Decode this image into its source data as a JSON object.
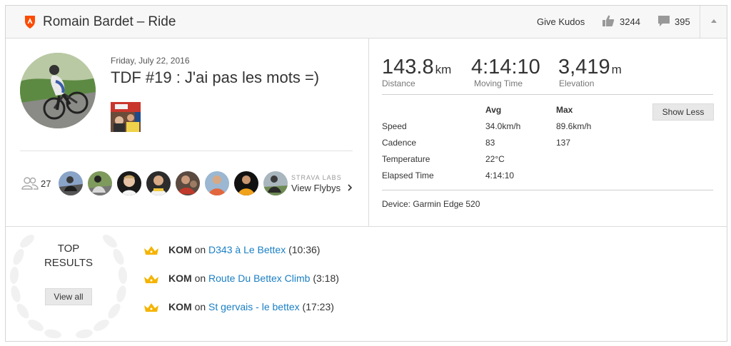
{
  "header": {
    "athlete_name": "Romain Bardet",
    "separator": "–",
    "activity_type": "Ride",
    "give_kudos_label": "Give Kudos",
    "kudos_count": "3244",
    "comment_count": "395"
  },
  "activity": {
    "date": "Friday, July 22, 2016",
    "name": "TDF #19 : J'ai pas les mots =)"
  },
  "group": {
    "athlete_count": "27",
    "labs_label": "STRAVA LABS",
    "flyby_label": "View Flybys"
  },
  "stats": {
    "distance": {
      "value": "143.8",
      "unit": "km",
      "label": "Distance"
    },
    "moving_time": {
      "value": "4:14:10",
      "label": "Moving Time"
    },
    "elevation": {
      "value": "3,419",
      "unit": "m",
      "label": "Elevation"
    },
    "table": {
      "col_avg": "Avg",
      "col_max": "Max",
      "rows": [
        {
          "label": "Speed",
          "avg": "34.0km/h",
          "max": "89.6km/h"
        },
        {
          "label": "Cadence",
          "avg": "83",
          "max": "137"
        },
        {
          "label": "Temperature",
          "avg": "22°C",
          "max": ""
        },
        {
          "label": "Elapsed Time",
          "avg": "4:14:10",
          "max": ""
        }
      ]
    },
    "show_less_label": "Show Less",
    "device": "Device: Garmin Edge 520"
  },
  "results": {
    "title": "TOP RESULTS",
    "view_all_label": "View all",
    "items": [
      {
        "achievement": "KOM",
        "on": "on",
        "segment": "D343 à Le Bettex",
        "time": "(10:36)"
      },
      {
        "achievement": "KOM",
        "on": "on",
        "segment": "Route Du Bettex Climb",
        "time": "(3:18)"
      },
      {
        "achievement": "KOM",
        "on": "on",
        "segment": "St gervais - le bettex",
        "time": "(17:23)"
      }
    ]
  },
  "colors": {
    "brand_orange": "#fc4c02",
    "link_blue": "#1a7fc4",
    "crown_gold": "#f5b400"
  }
}
